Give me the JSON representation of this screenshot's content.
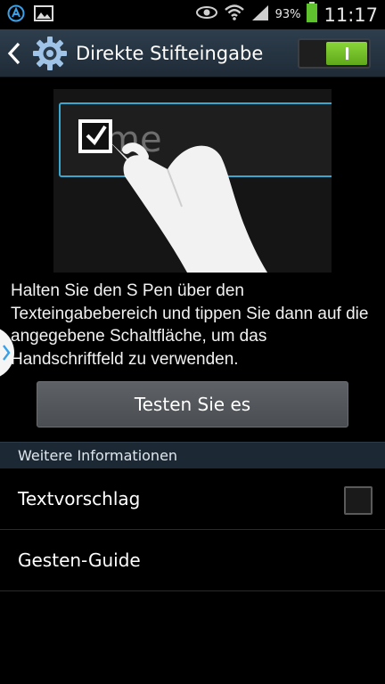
{
  "status_bar": {
    "battery_percent": "93%",
    "time": "11:17",
    "icons": [
      "android-a-icon",
      "image-icon",
      "eye-icon",
      "wifi-icon",
      "signal-icon",
      "battery-icon"
    ]
  },
  "action_bar": {
    "title": "Direkte Stifteingabe",
    "switch_on": true,
    "colors": {
      "switch_on": "#6abf28"
    }
  },
  "content": {
    "illustration_text": "me",
    "description": "Halten Sie den S Pen über den Texteingabebereich und tippen Sie dann auf die angegebene Schaltfläche, um das Handschriftfeld zu verwenden.",
    "try_button": "Testen Sie es"
  },
  "section": {
    "header": "Weitere Informationen",
    "items": [
      {
        "label": "Textvorschlag",
        "checked": false
      },
      {
        "label": "Gesten-Guide"
      }
    ]
  }
}
